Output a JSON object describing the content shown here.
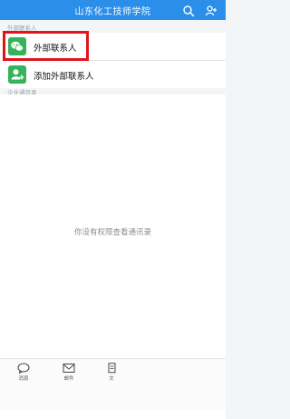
{
  "header": {
    "title": "山东化工技师学院"
  },
  "external_section": {
    "label": "外部联系人",
    "items": [
      {
        "label": "外部联系人"
      },
      {
        "label": "添加外部联系人"
      }
    ]
  },
  "enterprise_section": {
    "label": "企业通讯录"
  },
  "empty_state": {
    "message": "你没有权限查看通讯录"
  },
  "tabs": [
    {
      "label": "消息"
    },
    {
      "label": "邮件"
    },
    {
      "label": "文"
    }
  ],
  "colors": {
    "header": "#2b8ee8",
    "item_icon": "#35b35a",
    "highlight": "#e0141b"
  }
}
